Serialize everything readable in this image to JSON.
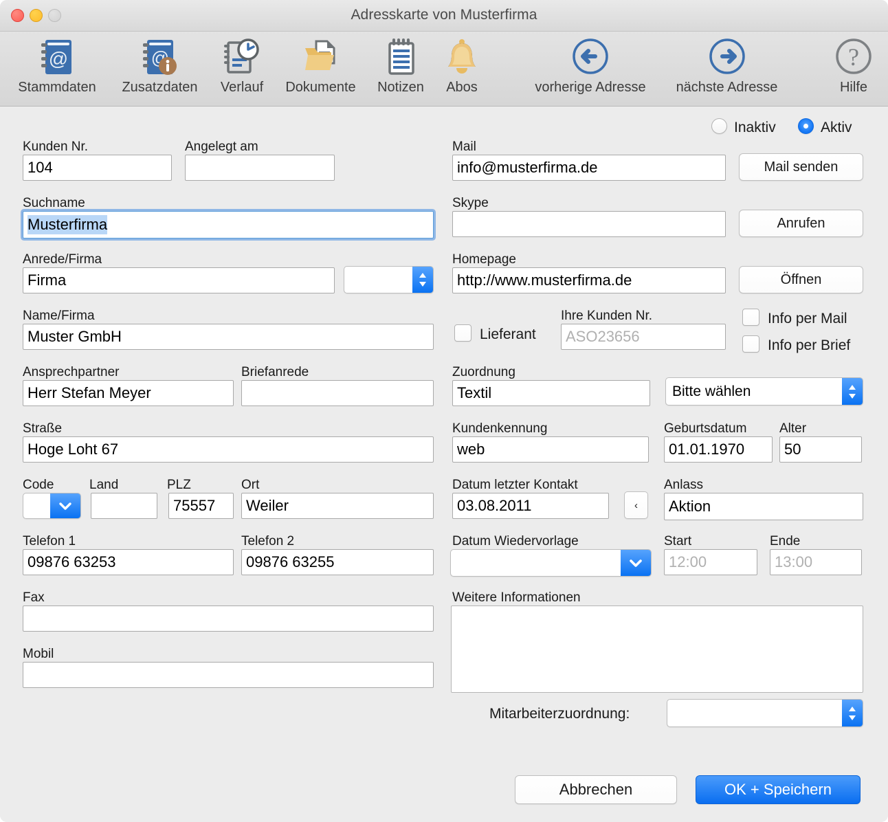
{
  "window": {
    "title": "Adresskarte von Musterfirma"
  },
  "toolbar": {
    "items": [
      {
        "label": "Stammdaten",
        "icon": "address-book-icon"
      },
      {
        "label": "Zusatzdaten",
        "icon": "address-book-info-icon"
      },
      {
        "label": "Verlauf",
        "icon": "history-clock-icon"
      },
      {
        "label": "Dokumente",
        "icon": "folder-document-icon"
      },
      {
        "label": "Notizen",
        "icon": "notepad-icon"
      },
      {
        "label": "Abos",
        "icon": "bell-icon"
      },
      {
        "label": "vorherige Adresse",
        "icon": "arrow-left-circle-icon"
      },
      {
        "label": "nächste Adresse",
        "icon": "arrow-right-circle-icon"
      },
      {
        "label": "Hilfe",
        "icon": "question-circle-icon"
      }
    ]
  },
  "status": {
    "inactive_label": "Inaktiv",
    "active_label": "Aktiv",
    "selected": "Aktiv"
  },
  "left": {
    "kunden_nr": {
      "label": "Kunden Nr.",
      "value": "104"
    },
    "angelegt_am": {
      "label": "Angelegt am",
      "value": ""
    },
    "suchname": {
      "label": "Suchname",
      "value": "Musterfirma",
      "focused": true,
      "selected": true
    },
    "anrede_firma": {
      "label": "Anrede/Firma",
      "value": "Firma"
    },
    "anrede_stepper": {
      "value": ""
    },
    "name_firma": {
      "label": "Name/Firma",
      "value": "Muster GmbH"
    },
    "ansprechpartner": {
      "label": "Ansprechpartner",
      "value": "Herr Stefan Meyer"
    },
    "briefanrede": {
      "label": "Briefanrede",
      "value": ""
    },
    "strasse": {
      "label": "Straße",
      "value": "Hoge Loht 67"
    },
    "code": {
      "label": "Code",
      "value": ""
    },
    "land": {
      "label": "Land",
      "value": ""
    },
    "plz": {
      "label": "PLZ",
      "value": "75557"
    },
    "ort": {
      "label": "Ort",
      "value": "Weiler"
    },
    "telefon1": {
      "label": "Telefon 1",
      "value": "09876 63253"
    },
    "telefon2": {
      "label": "Telefon 2",
      "value": "09876 63255"
    },
    "fax": {
      "label": "Fax",
      "value": ""
    },
    "mobil": {
      "label": "Mobil",
      "value": ""
    }
  },
  "right": {
    "mail": {
      "label": "Mail",
      "value": "info@musterfirma.de",
      "button": "Mail senden"
    },
    "skype": {
      "label": "Skype",
      "value": "",
      "button": "Anrufen"
    },
    "homepage": {
      "label": "Homepage",
      "value": "http://www.musterfirma.de",
      "button": "Öffnen"
    },
    "lieferant": {
      "label": "Lieferant",
      "checked": false
    },
    "ihre_kunden_nr": {
      "label": "Ihre Kunden Nr.",
      "placeholder": "ASO23656",
      "value": ""
    },
    "info_per_mail": {
      "label": "Info per Mail",
      "checked": false
    },
    "info_per_brief": {
      "label": "Info per Brief",
      "checked": false
    },
    "zuordnung": {
      "label": "Zuordnung",
      "value": "Textil"
    },
    "zuordnung_select": {
      "value": "Bitte wählen"
    },
    "kundenkennung": {
      "label": "Kundenkennung",
      "value": "web"
    },
    "geburtsdatum": {
      "label": "Geburtsdatum",
      "value": "01.01.1970"
    },
    "alter": {
      "label": "Alter",
      "value": "50"
    },
    "datum_letzter_kontakt": {
      "label": "Datum letzter Kontakt",
      "value": "03.08.2011",
      "button": "‹"
    },
    "anlass": {
      "label": "Anlass",
      "value": "Aktion"
    },
    "datum_wiedervorlage": {
      "label": "Datum Wiedervorlage",
      "value": ""
    },
    "start": {
      "label": "Start",
      "placeholder": "12:00",
      "value": ""
    },
    "ende": {
      "label": "Ende",
      "placeholder": "13:00",
      "value": ""
    },
    "weitere_infos": {
      "label": "Weitere Informationen",
      "value": ""
    },
    "mitarbeiterzuordnung": {
      "label": "Mitarbeiterzuordnung:",
      "value": ""
    }
  },
  "footer": {
    "cancel_label": "Abbrechen",
    "save_label": "OK + Speichern"
  },
  "colors": {
    "accent": "#1578f5",
    "toolbar_blue": "#3c6fae",
    "toolbar_gold": "#e8bb62",
    "toolbar_gray": "#6e7376"
  }
}
